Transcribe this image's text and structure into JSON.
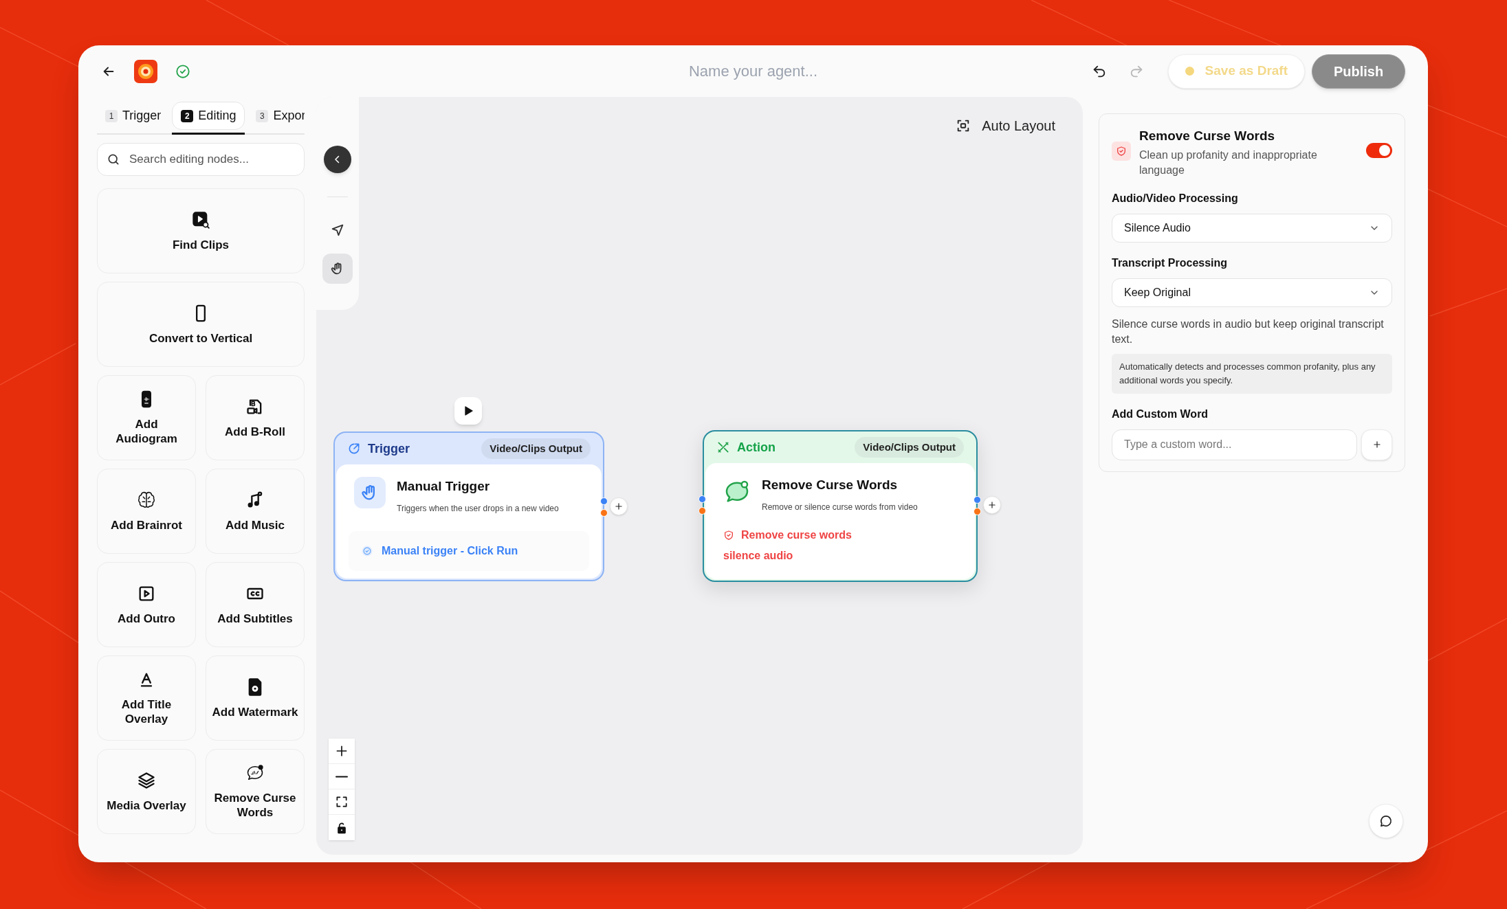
{
  "header": {
    "title_placeholder": "Name your agent...",
    "undo": {
      "disabled": false
    },
    "redo": {
      "disabled": true
    },
    "actions": [
      {
        "kind": "draft",
        "label": "Save as Draft"
      },
      {
        "kind": "publish",
        "label": "Publish"
      }
    ]
  },
  "tabs": [
    {
      "number": "1",
      "label": "Trigger",
      "selected": false
    },
    {
      "number": "2",
      "label": "Editing",
      "selected": true
    },
    {
      "number": "3",
      "label": "Expor",
      "selected": false
    }
  ],
  "search": {
    "placeholder": "Search editing nodes..."
  },
  "palette": [
    {
      "kind": "wide",
      "label": "Find Clips"
    },
    {
      "kind": "wide",
      "label": "Convert to Vertical"
    },
    {
      "kind": "half",
      "label": "Add Audiogram"
    },
    {
      "kind": "half",
      "label": "Add B-Roll"
    },
    {
      "kind": "half",
      "label": "Add Brainrot"
    },
    {
      "kind": "half",
      "label": "Add Music"
    },
    {
      "kind": "half",
      "label": "Add Outro"
    },
    {
      "kind": "half",
      "label": "Add Subtitles"
    },
    {
      "kind": "half",
      "label": "Add Title Overlay"
    },
    {
      "kind": "half",
      "label": "Add Watermark"
    },
    {
      "kind": "half",
      "label": "Media Overlay"
    },
    {
      "kind": "half",
      "label": "Remove Curse Words"
    }
  ],
  "canvas": {
    "auto_layout": "Auto Layout",
    "tools": [
      {
        "selected": false
      },
      {
        "selected": true
      }
    ],
    "nodes": [
      {
        "kind": "trigger",
        "selected": false,
        "header": "Trigger",
        "badge": "Video/Clips Output",
        "title": "Manual Trigger",
        "description": "Triggers when the user drops in a new video",
        "details": [
          "Manual trigger - Click Run"
        ]
      },
      {
        "kind": "action",
        "selected": true,
        "header": "Action",
        "badge": "Video/Clips Output",
        "title": "Remove Curse Words",
        "description": "Remove or silence curse words from video",
        "details": [
          "Remove curse words",
          "silence audio"
        ]
      }
    ]
  },
  "settings": {
    "title": "Remove Curse Words",
    "subtitle": "Clean up profanity and inappropriate language",
    "enabled": true,
    "fields": [
      {
        "label": "Audio/Video Processing",
        "value": "Silence Audio"
      },
      {
        "label": "Transcript Processing",
        "value": "Keep Original"
      }
    ],
    "help": "Silence curse words in audio but keep original transcript text.",
    "note": "Automatically detects and processes common profanity, plus any additional words you specify.",
    "custom_word": {
      "label": "Add Custom Word",
      "placeholder": "Type a custom word..."
    }
  }
}
